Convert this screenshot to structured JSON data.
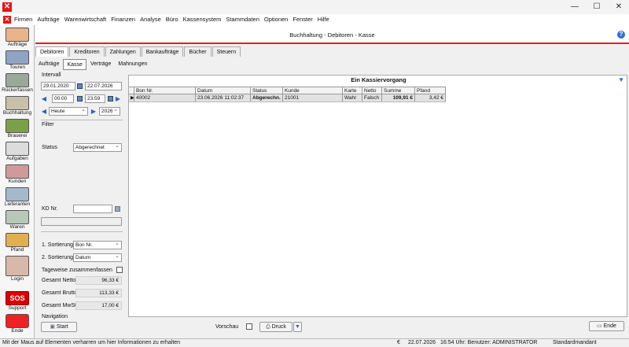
{
  "window": {
    "minimize": "—",
    "maximize": "☐",
    "close": "✕"
  },
  "menu": [
    "Firmen",
    "Aufträge",
    "Warenwirtschaft",
    "Finanzen",
    "Analyse",
    "Büro",
    "Kassensystem",
    "Stammdaten",
    "Optionen",
    "Fenster",
    "Hilfe"
  ],
  "sidebar": [
    "Aufträge",
    "Touren",
    "Rückerfassen",
    "Buchhaltung",
    "Brauerei",
    "Aufgaben",
    "Kunden",
    "Lieferanten",
    "Waren",
    "Pfand",
    "Login",
    "Support",
    "Ende"
  ],
  "sidebar_sos": "SOS",
  "header": {
    "title": "Buchhaltung - Debitoren - Kasse",
    "help": "?"
  },
  "tabs": [
    "Debitoren",
    "Kreditoren",
    "Zahlungen",
    "Bankaufträge",
    "Bücher",
    "Steuern"
  ],
  "subtabs": [
    "Aufträge",
    "Kasse",
    "Verträge",
    "Mahnungen"
  ],
  "left": {
    "intervall_label": "Intervall",
    "date_from": "29.01.2020",
    "date_to": "22.07.2026",
    "time_from": "00:00",
    "time_to": "23:59",
    "preset": "Heute",
    "year": "2026",
    "filter_label": "Filter",
    "status_label": "Status",
    "status_value": "Abgerechnet",
    "kd_label": "KD Nr.",
    "kd_value": "",
    "sort1_label": "1. Sortierung",
    "sort1_value": "Bon Nr.",
    "sort2_label": "2. Sortierung",
    "sort2_value": "Datum",
    "daily_label": "Tageweise zusammenfassen",
    "gesamt_netto_label": "Gesamt Netto",
    "gesamt_netto_value": "96,33 €",
    "gesamt_brutto_label": "Gesamt Brutto",
    "gesamt_brutto_value": "113,33 €",
    "gesamt_mwst_label": "Gesamt MwSt.",
    "gesamt_mwst_value": "17,00 €",
    "navigation_label": "Navigation",
    "start_label": "Start"
  },
  "grid": {
    "title": "Ein Kassiervorgang",
    "columns": [
      "Bon Nr.",
      "Datum",
      "Status",
      "Kunde",
      "Karte",
      "Netto",
      "Summe",
      "Pfand"
    ],
    "row": [
      "40002",
      "23.06.2026 11:02:37",
      "Abgerechn.",
      "21001",
      "Wahr",
      "Falsch",
      "109,91 €",
      "3,42 €"
    ],
    "row_marker": "▶"
  },
  "bottom": {
    "vorschau_label": "Vorschau",
    "druck_label": "Druck",
    "ende_label": "Ende"
  },
  "status": {
    "hint": "Mit der Maus auf Elementen verharren um hier Informationen zu erhalten",
    "currency": "€",
    "date": "22.07.2026",
    "time_user": "16:54 Uhr: Benutzer: ADMINISTRATOR",
    "mandant": "Standardmandant"
  },
  "colors": {
    "accent_red": "#dd2222",
    "link_blue": "#2a64c5"
  }
}
